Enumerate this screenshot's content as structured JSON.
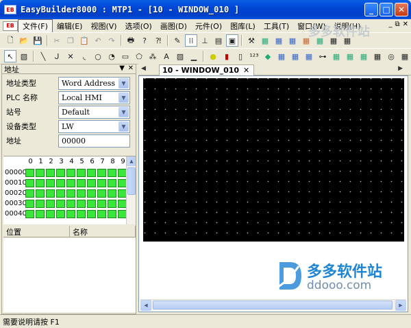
{
  "window": {
    "app_logo": "EB",
    "title": "EasyBuilder8000 : MTP1 - [10 - WINDOW_010 ]",
    "minimize": "_",
    "maximize": "□",
    "close": "✕"
  },
  "menu": {
    "logo": "EB",
    "items": [
      {
        "label": "文件(F)"
      },
      {
        "label": "编辑(E)"
      },
      {
        "label": "视图(V)"
      },
      {
        "label": "选项(O)"
      },
      {
        "label": "画图(D)"
      },
      {
        "label": "元件(O)"
      },
      {
        "label": "图库(L)"
      },
      {
        "label": "工具(T)"
      },
      {
        "label": "窗口(W)"
      },
      {
        "label": "说明(H)"
      }
    ],
    "mdi_minimize": "_",
    "mdi_restore": "⧉",
    "mdi_close": "✕"
  },
  "left_panel": {
    "title": "地址",
    "pin": "▼",
    "close": "✕",
    "fields": [
      {
        "label": "地址类型",
        "value": "Word Address"
      },
      {
        "label": "PLC 名称",
        "value": "Local HMI"
      },
      {
        "label": "站号",
        "value": "Default"
      },
      {
        "label": "设备类型",
        "value": "LW"
      },
      {
        "label": "地址",
        "value": "00000"
      }
    ],
    "bit_columns": [
      "0",
      "1",
      "2",
      "3",
      "4",
      "5",
      "6",
      "7",
      "8",
      "9"
    ],
    "bit_rows": [
      "00000",
      "00010",
      "00020",
      "00030",
      "00040"
    ],
    "list_columns": [
      "位置",
      "名称"
    ]
  },
  "tabs": [
    {
      "label": "10 - WINDOW_010",
      "close": "✕"
    }
  ],
  "watermark": {
    "top_text": "多多软件站",
    "brand_cn": "多多软件站",
    "brand_url": "ddooo.com"
  },
  "status": {
    "text": "需要说明请按 F1"
  }
}
